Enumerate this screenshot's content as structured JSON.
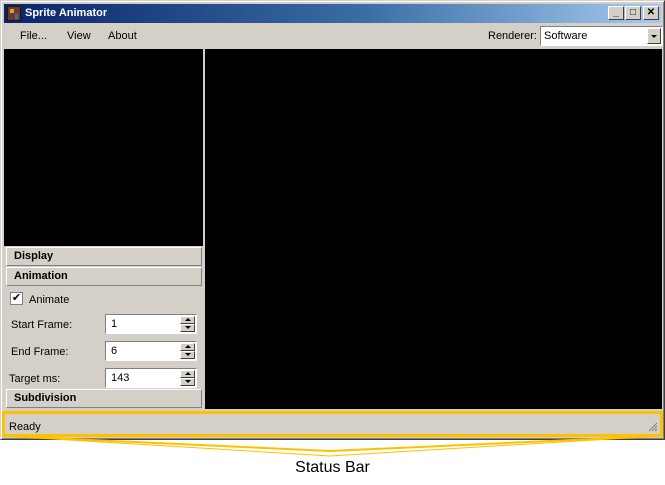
{
  "window": {
    "title": "Sprite Animator"
  },
  "title_buttons": {
    "minimize": "_",
    "maximize": "□",
    "close": "✕"
  },
  "menu": {
    "items": [
      "File...",
      "View",
      "About"
    ]
  },
  "renderer": {
    "label": "Renderer:",
    "value": "Software"
  },
  "panels": {
    "display": "Display",
    "animation": "Animation",
    "subdivision": "Subdivision"
  },
  "animation": {
    "animate_label": "Animate",
    "animate_checked": true,
    "check_mark": "✔",
    "start_frame_label": "Start Frame:",
    "start_frame_value": "1",
    "end_frame_label": "End Frame:",
    "end_frame_value": "6",
    "target_ms_label": "Target ms:",
    "target_ms_value": "143"
  },
  "status": {
    "text": "Ready"
  },
  "callout": {
    "label": "Status Bar",
    "color": "#ffc000"
  },
  "colors": {
    "titlebar_start": "#0a246a",
    "titlebar_end": "#a6caf0",
    "face": "#d4d0c8",
    "viewport": "#000000"
  }
}
